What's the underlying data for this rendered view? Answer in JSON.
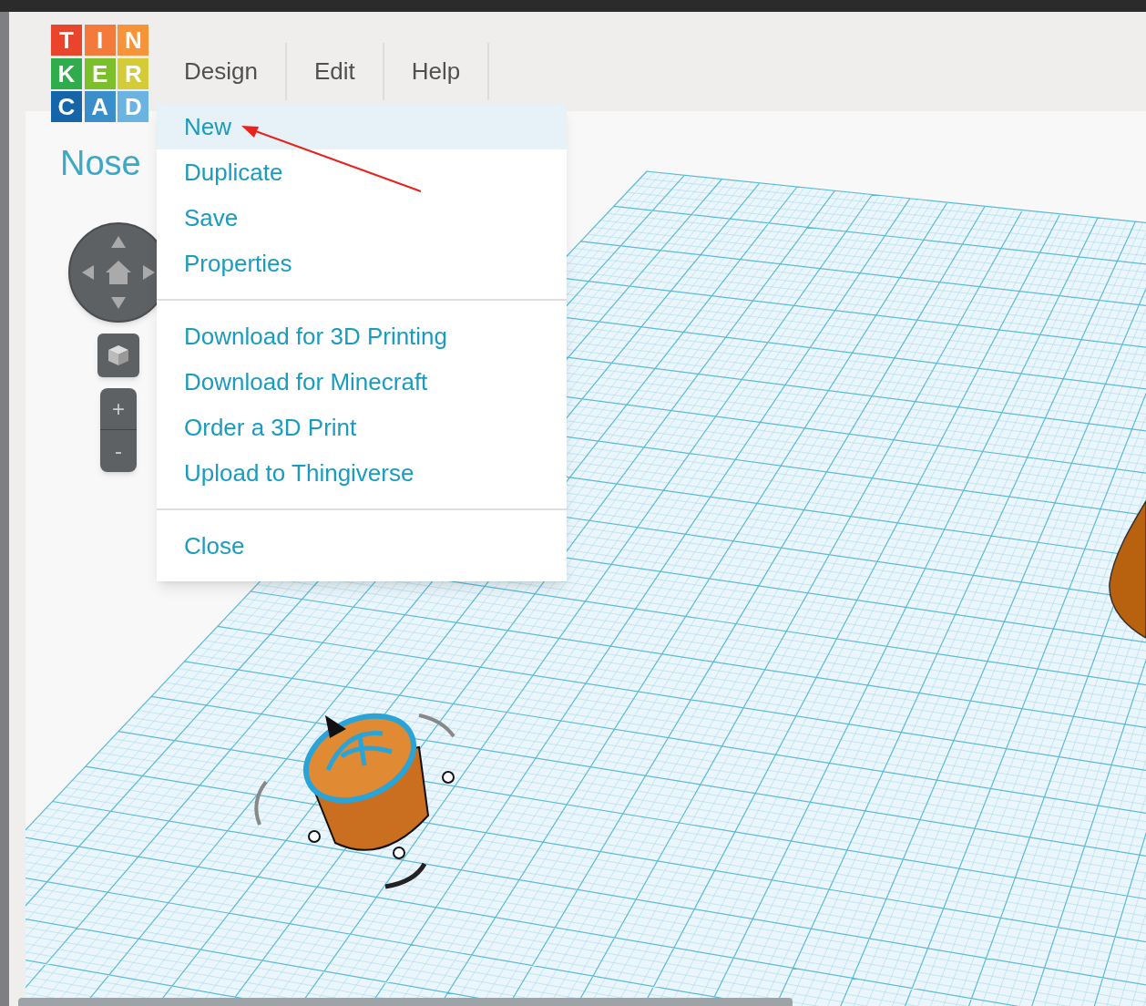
{
  "logo": {
    "tiles": [
      {
        "letter": "T",
        "color": "#e8452c"
      },
      {
        "letter": "I",
        "color": "#f37a3b"
      },
      {
        "letter": "N",
        "color": "#f7943a"
      },
      {
        "letter": "K",
        "color": "#2fac4b"
      },
      {
        "letter": "E",
        "color": "#7bbf2a"
      },
      {
        "letter": "R",
        "color": "#d3cb38"
      },
      {
        "letter": "C",
        "color": "#1665a8"
      },
      {
        "letter": "A",
        "color": "#3a8fcb"
      },
      {
        "letter": "D",
        "color": "#6bb3e0"
      }
    ]
  },
  "menu_bar": [
    {
      "label": "Design"
    },
    {
      "label": "Edit"
    },
    {
      "label": "Help"
    }
  ],
  "design_title": "Nose",
  "dropdown": {
    "sections": [
      [
        {
          "label": "New",
          "selected": true
        },
        {
          "label": "Duplicate",
          "selected": false
        },
        {
          "label": "Save",
          "selected": false
        },
        {
          "label": "Properties",
          "selected": false
        }
      ],
      [
        {
          "label": "Download for 3D Printing",
          "selected": false
        },
        {
          "label": "Download for Minecraft",
          "selected": false
        },
        {
          "label": "Order a 3D Print",
          "selected": false
        },
        {
          "label": "Upload to Thingiverse",
          "selected": false
        }
      ],
      [
        {
          "label": "Close",
          "selected": false
        }
      ]
    ]
  },
  "view_controls": {
    "zoom_in": "+",
    "zoom_out": "-"
  }
}
